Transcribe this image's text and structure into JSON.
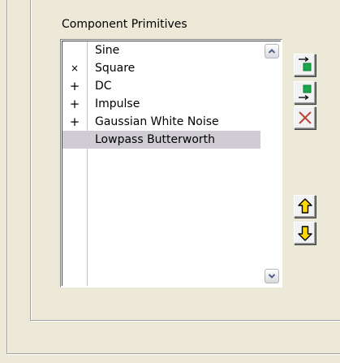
{
  "group": {
    "label": "Component Primitives"
  },
  "list": {
    "items": [
      {
        "marker": "",
        "label": "Sine",
        "selected": false
      },
      {
        "marker": "×",
        "label": "Square",
        "selected": false
      },
      {
        "marker": "+",
        "label": "DC",
        "selected": false
      },
      {
        "marker": "+",
        "label": "Impulse",
        "selected": false
      },
      {
        "marker": "+",
        "label": "Gaussian White Noise",
        "selected": false
      },
      {
        "marker": "",
        "label": "Lowpass Butterworth",
        "selected": true
      }
    ]
  },
  "icons": {
    "scroll_up": "chevron-up-icon",
    "scroll_down": "chevron-down-icon",
    "insert_above": "insert-above-icon",
    "insert_below": "insert-below-icon",
    "delete": "delete-x-icon",
    "move_up": "yellow-arrow-up-icon",
    "move_down": "yellow-arrow-down-icon"
  },
  "colors": {
    "background": "#ece9d8",
    "selected_row": "#d0ccd4",
    "insert_square": "#1aa84a",
    "delete_x": "#b84a3c",
    "arrow_fill": "#ffd800"
  }
}
